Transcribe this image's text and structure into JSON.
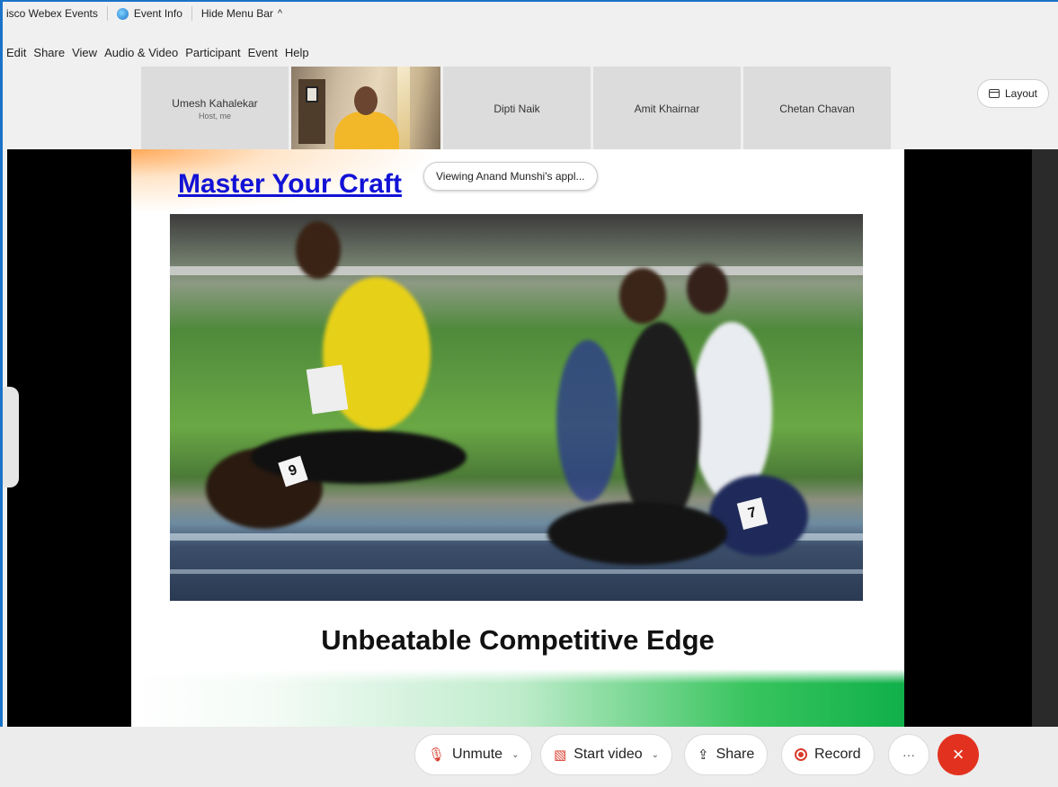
{
  "titlebar": {
    "app_name": "isco Webex Events",
    "event_info": "Event Info",
    "hide_menu_bar": "Hide Menu Bar",
    "caret": "^"
  },
  "menu": {
    "items": [
      "Edit",
      "Share",
      "View",
      "Audio & Video",
      "Participant",
      "Event",
      "Help"
    ]
  },
  "participants": [
    {
      "name": "Umesh Kahalekar",
      "role": "Host, me"
    },
    {
      "name": "Dipti Naik"
    },
    {
      "name": "Amit Khairnar"
    },
    {
      "name": "Chetan Chavan"
    }
  ],
  "layout_button": "Layout",
  "viewing_status": "Viewing Anand Munshi's appl...",
  "slide": {
    "title": "Master Your Craft",
    "subtitle": "Unbeatable Competitive Edge",
    "bib_left": "9",
    "bib_right": "7"
  },
  "controls": {
    "unmute": "Unmute",
    "start_video": "Start video",
    "share": "Share",
    "record": "Record",
    "more": "···",
    "end": "×"
  },
  "colors": {
    "accent": "#1a73c8",
    "end_call": "#e2321f",
    "slide_title": "#1212d6"
  }
}
